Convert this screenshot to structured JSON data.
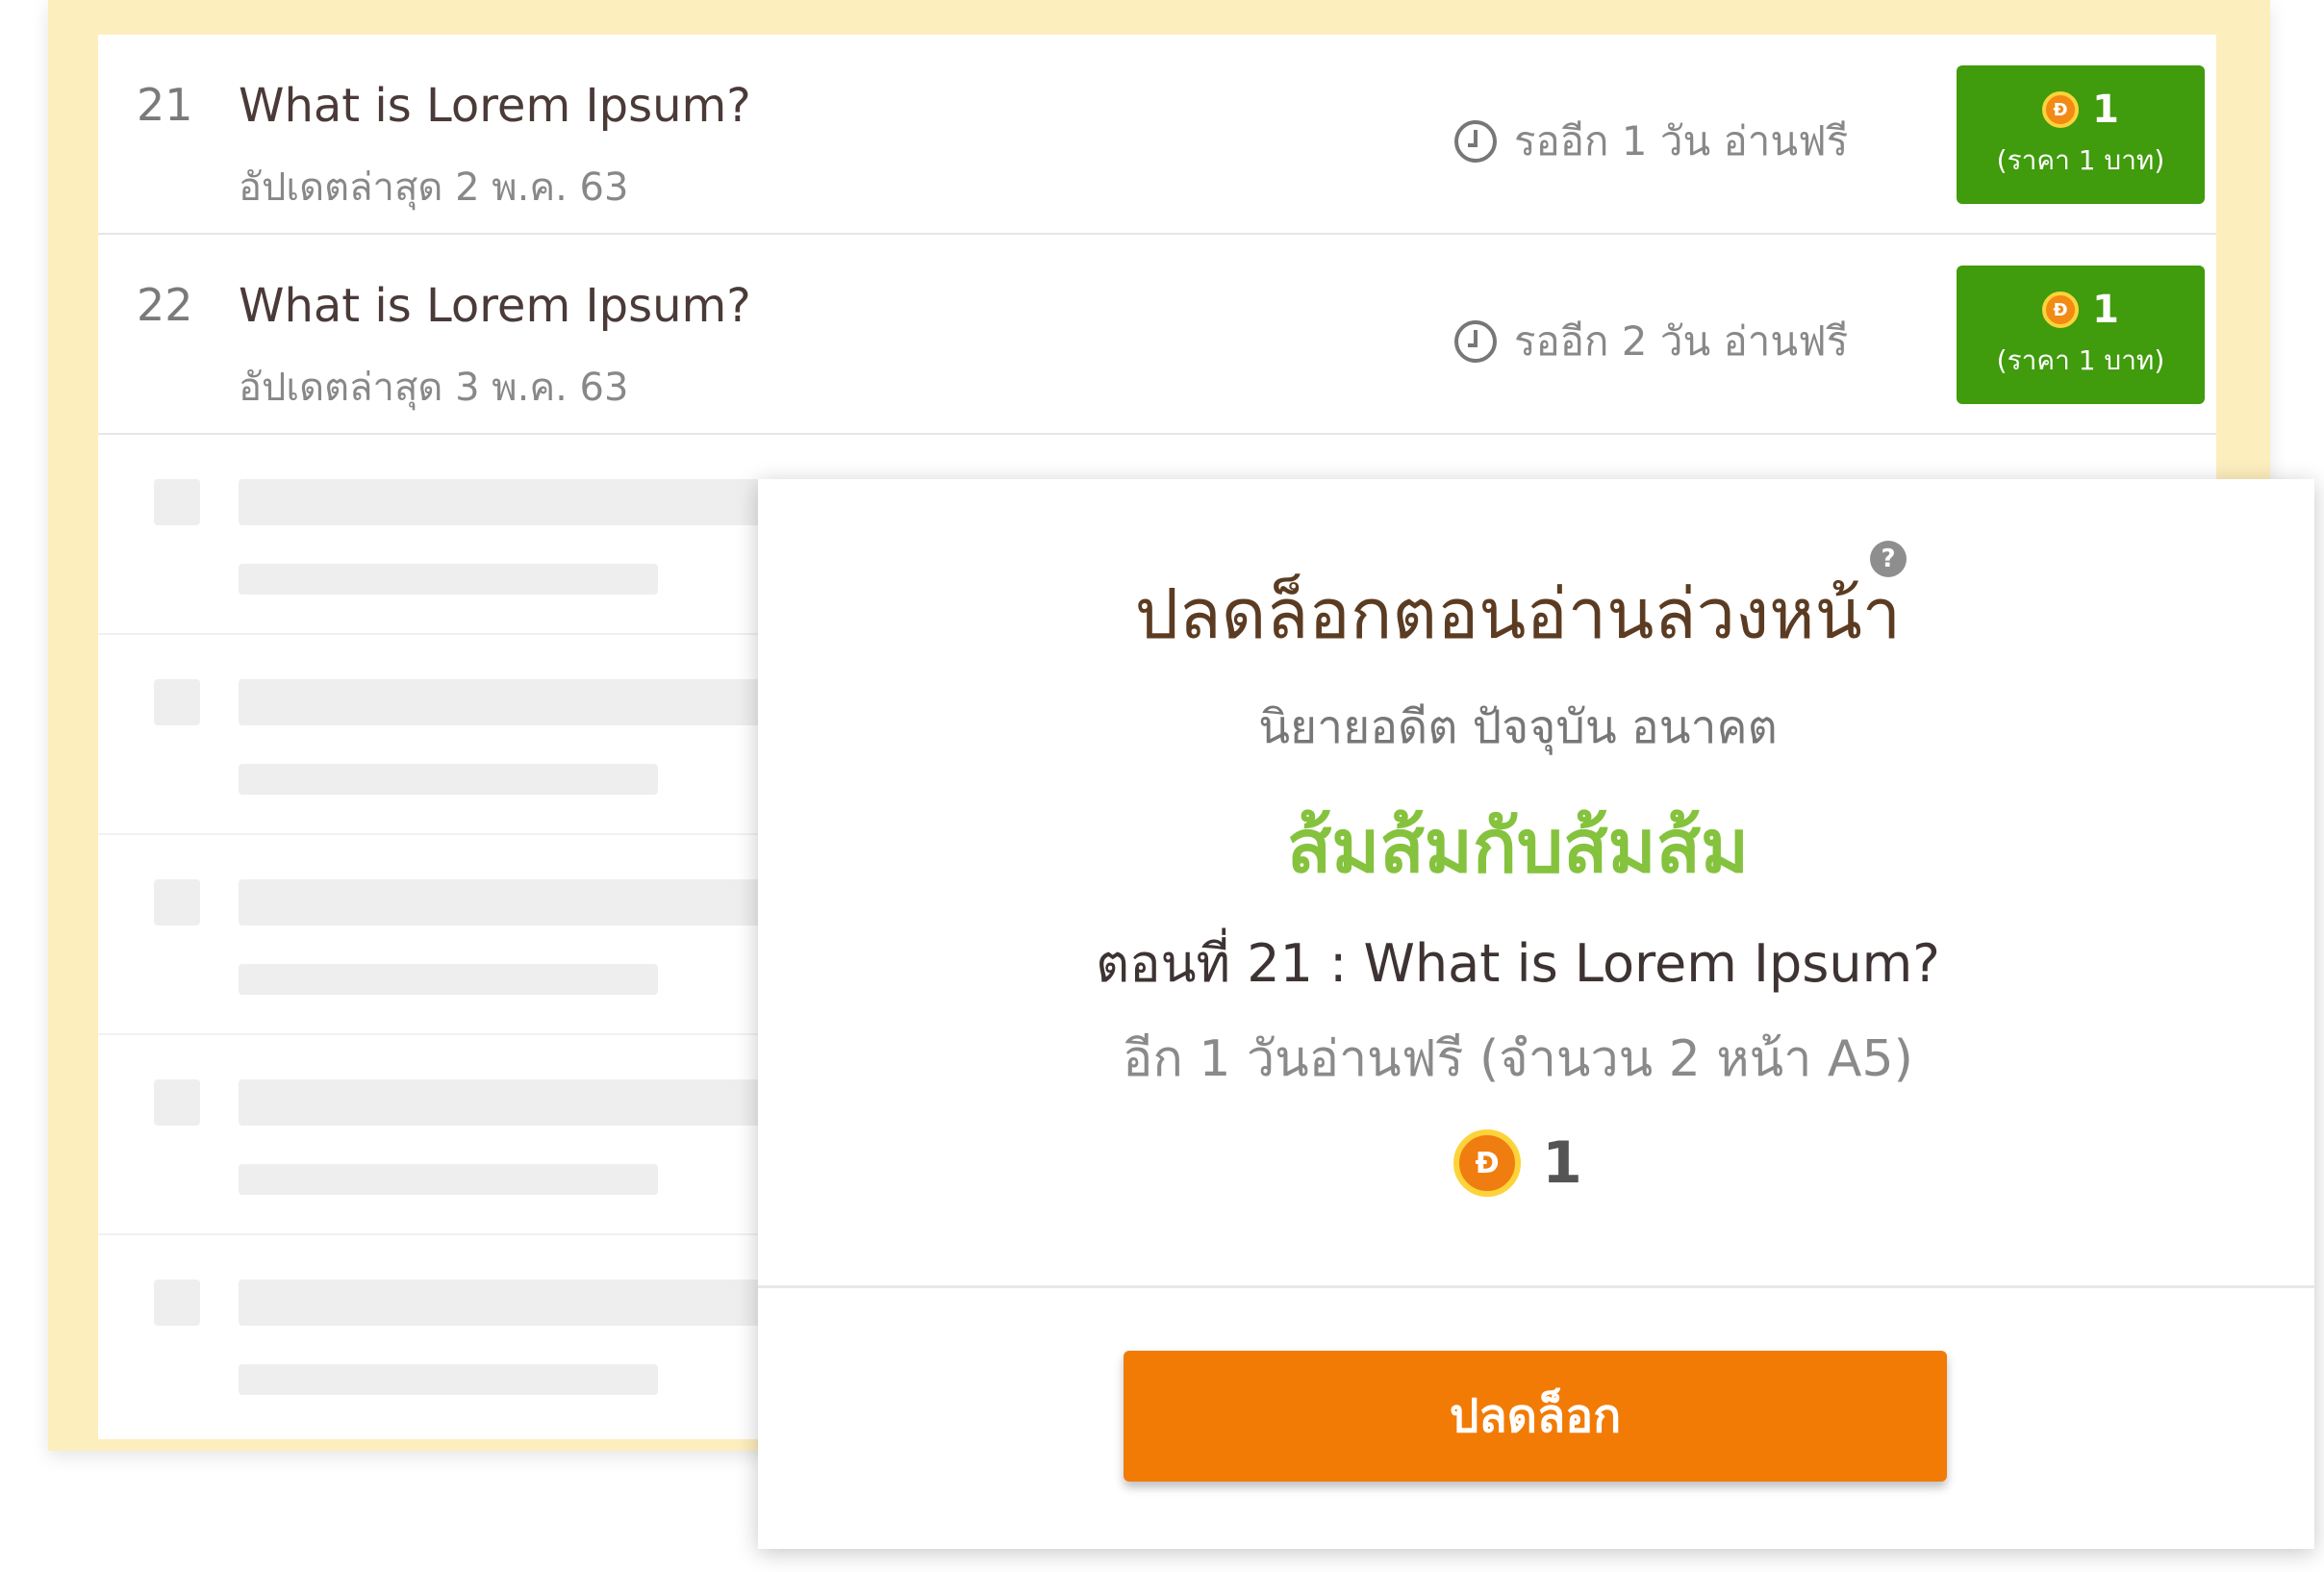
{
  "episodes": [
    {
      "number": "21",
      "title": "What is Lorem Ipsum?",
      "updated": "อัปเดตล่าสุด 2 พ.ค. 63",
      "wait_text": "รออีก 1 วัน อ่านฟรี",
      "price": "1",
      "price_note": "(ราคา 1 บาท)"
    },
    {
      "number": "22",
      "title": "What is Lorem Ipsum?",
      "updated": "อัปเดตล่าสุด 3 พ.ค. 63",
      "wait_text": "รออีก 2 วัน อ่านฟรี",
      "price": "1",
      "price_note": "(ราคา 1 บาท)"
    }
  ],
  "modal": {
    "title": "ปลดล็อกตอนอ่านล่วงหน้า",
    "help_symbol": "?",
    "subtitle": "นิยายอดีต ปัจจุบัน อนาคต",
    "novel_name": "ส้มส้มกับส้มส้ม",
    "episode": "ตอนที่ 21 : What is Lorem Ipsum?",
    "free_info": "อีก 1 วันอ่านฟรี (จำนวน 2 หน้า A5)",
    "price": "1",
    "unlock_label": "ปลดล็อก"
  },
  "coin_symbol": "Ɖ",
  "colors": {
    "price_button": "#409b0d",
    "unlock_button": "#f27b06",
    "novel_name": "#85c23e",
    "modal_title": "#5b3c22",
    "card_border": "#fdeebe"
  },
  "icons": [
    "clock-icon",
    "coin-icon",
    "help-icon"
  ]
}
